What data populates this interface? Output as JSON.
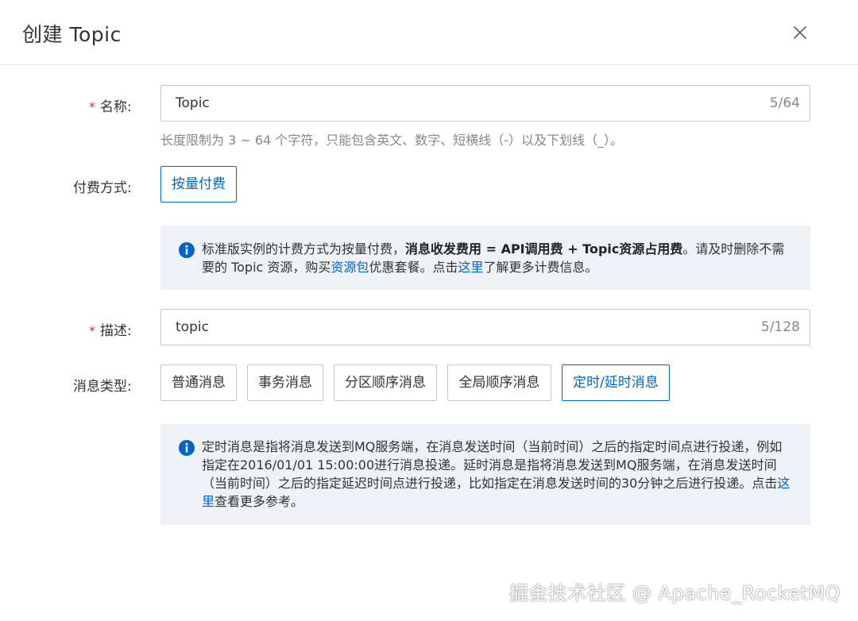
{
  "dialog": {
    "title": "创建 Topic"
  },
  "form": {
    "name": {
      "required_mark": "*",
      "label": "名称:",
      "value": "Topic",
      "count": "5/64",
      "hint": "长度限制为 3 ~ 64 个字符，只能包含英文、数字、短横线（-）以及下划线（_）。"
    },
    "billing": {
      "label": "付费方式:",
      "option": "按量付费",
      "notice": {
        "part1": "标准版实例的计费方式为按量付费，",
        "bold": "消息收发费用 = API调用费 + Topic资源占用费",
        "part2": "。请及时删除不需要的 Topic 资源，购买",
        "link1": "资源包",
        "part3": "优惠套餐。点击",
        "link2": "这里",
        "part4": "了解更多计费信息。"
      }
    },
    "description": {
      "required_mark": "*",
      "label": "描述:",
      "value": "topic",
      "count": "5/128"
    },
    "message_type": {
      "label": "消息类型:",
      "options": [
        "普通消息",
        "事务消息",
        "分区顺序消息",
        "全局顺序消息",
        "定时/延时消息"
      ],
      "selected": "定时/延时消息",
      "notice": {
        "part1": "定时消息是指将消息发送到MQ服务端，在消息发送时间（当前时间）之后的指定时间点进行投递，例如指定在2016/01/01 15:00:00进行消息投递。延时消息是指将消息发送到MQ服务端，在消息发送时间（当前时间）之后的指定延迟时间点进行投递，比如指定在消息发送时间的30分钟之后进行投递。点击",
        "link": "这里",
        "part2": "查看更多参考。"
      }
    }
  },
  "watermark": "掘金技术社区 @ Apache_RocketMQ",
  "colors": {
    "primary": "#0064c8",
    "required": "#d93026",
    "notice_bg": "#eef1f6",
    "border": "#c6c6c6"
  },
  "icons": {
    "close": "close-icon",
    "info": "info-icon"
  }
}
